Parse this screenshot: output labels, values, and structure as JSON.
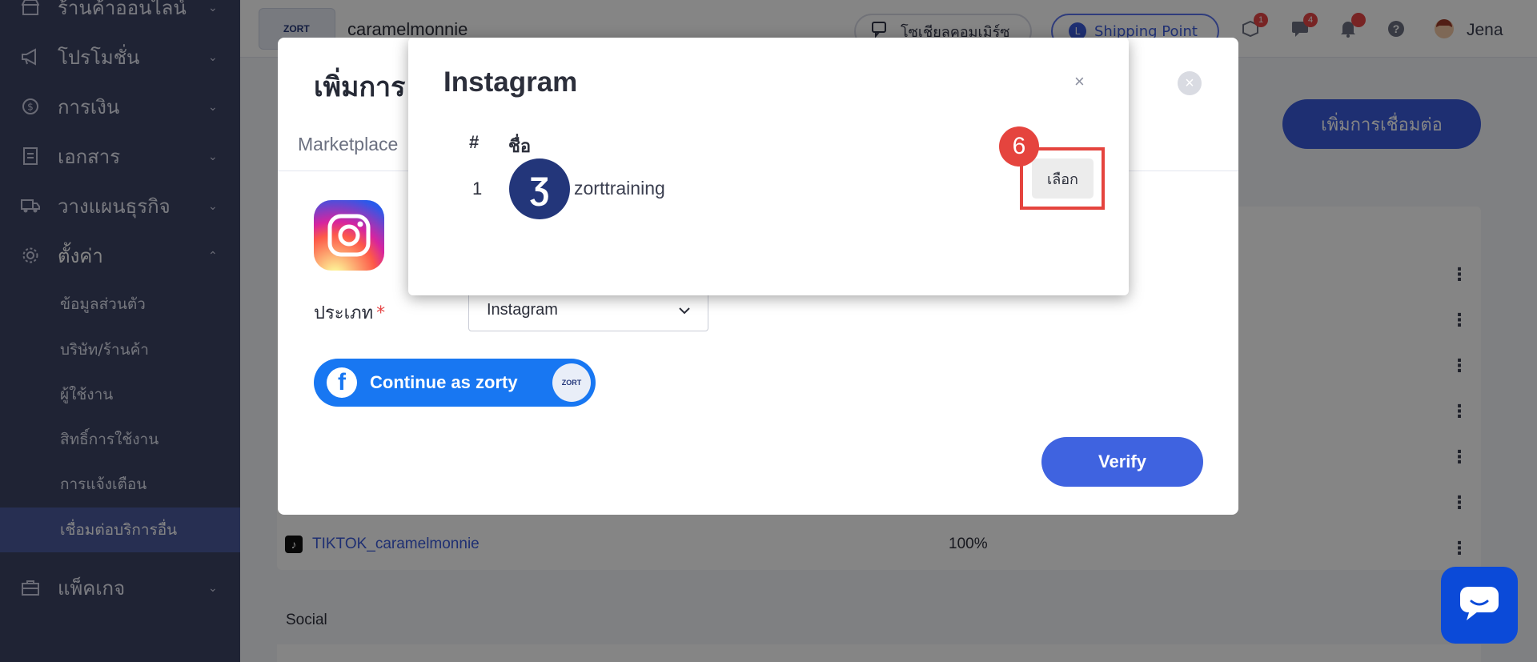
{
  "sidebar": {
    "items": [
      {
        "label": "ร้านค้าออนไลน์",
        "icon": "store-icon"
      },
      {
        "label": "โปรโมชั่น",
        "icon": "megaphone-icon"
      },
      {
        "label": "การเงิน",
        "icon": "dollar-icon"
      },
      {
        "label": "เอกสาร",
        "icon": "document-icon"
      },
      {
        "label": "วางแผนธุรกิจ",
        "icon": "truck-icon"
      },
      {
        "label": "ตั้งค่า",
        "icon": "gear-icon"
      }
    ],
    "sub_items": [
      {
        "label": "ข้อมูลส่วนตัว"
      },
      {
        "label": "บริษัท/ร้านค้า"
      },
      {
        "label": "ผู้ใช้งาน"
      },
      {
        "label": "สิทธิ์การใช้งาน"
      },
      {
        "label": "การแจ้งเตือน"
      },
      {
        "label": "เชื่อมต่อบริการอื่น"
      }
    ],
    "bottom_item": {
      "label": "แพ็คเกจ",
      "icon": "briefcase-icon"
    }
  },
  "topbar": {
    "store_name": "caramelmonnie",
    "logo_text": "ZORT",
    "pill_1": "โซเชียลคอมเมิร์ซ",
    "pill_2": "Shipping Point",
    "badge_1": "1",
    "badge_2": "4",
    "user_name": "Jena"
  },
  "background": {
    "add_button": "เพิ่มการเชื่อมต่อ",
    "row_name": "TIKTOK_caramelmonnie",
    "row_pct": "100%",
    "section_social": "Social"
  },
  "modal": {
    "title": "เพิ่มการ",
    "tab_marketplace": "Marketplace",
    "type_label": "ประเภท",
    "required_mark": "*",
    "type_value": "Instagram",
    "fb_button": "Continue as zorty",
    "fb_avatar_text": "ZORT",
    "verify": "Verify"
  },
  "instagram_modal": {
    "title": "Instagram",
    "close": "×",
    "col_hash": "#",
    "col_name": "ชื่อ",
    "rows": [
      {
        "num": "1",
        "name": "zorttraining",
        "avatar_letter": "Ʒ",
        "action": "เลือก"
      }
    ]
  },
  "annotation": {
    "step": "6",
    "color": "#e5443e"
  },
  "colors": {
    "sidebar_bg": "#3d4465",
    "primary": "#3b5bdb",
    "facebook": "#1877f2"
  }
}
